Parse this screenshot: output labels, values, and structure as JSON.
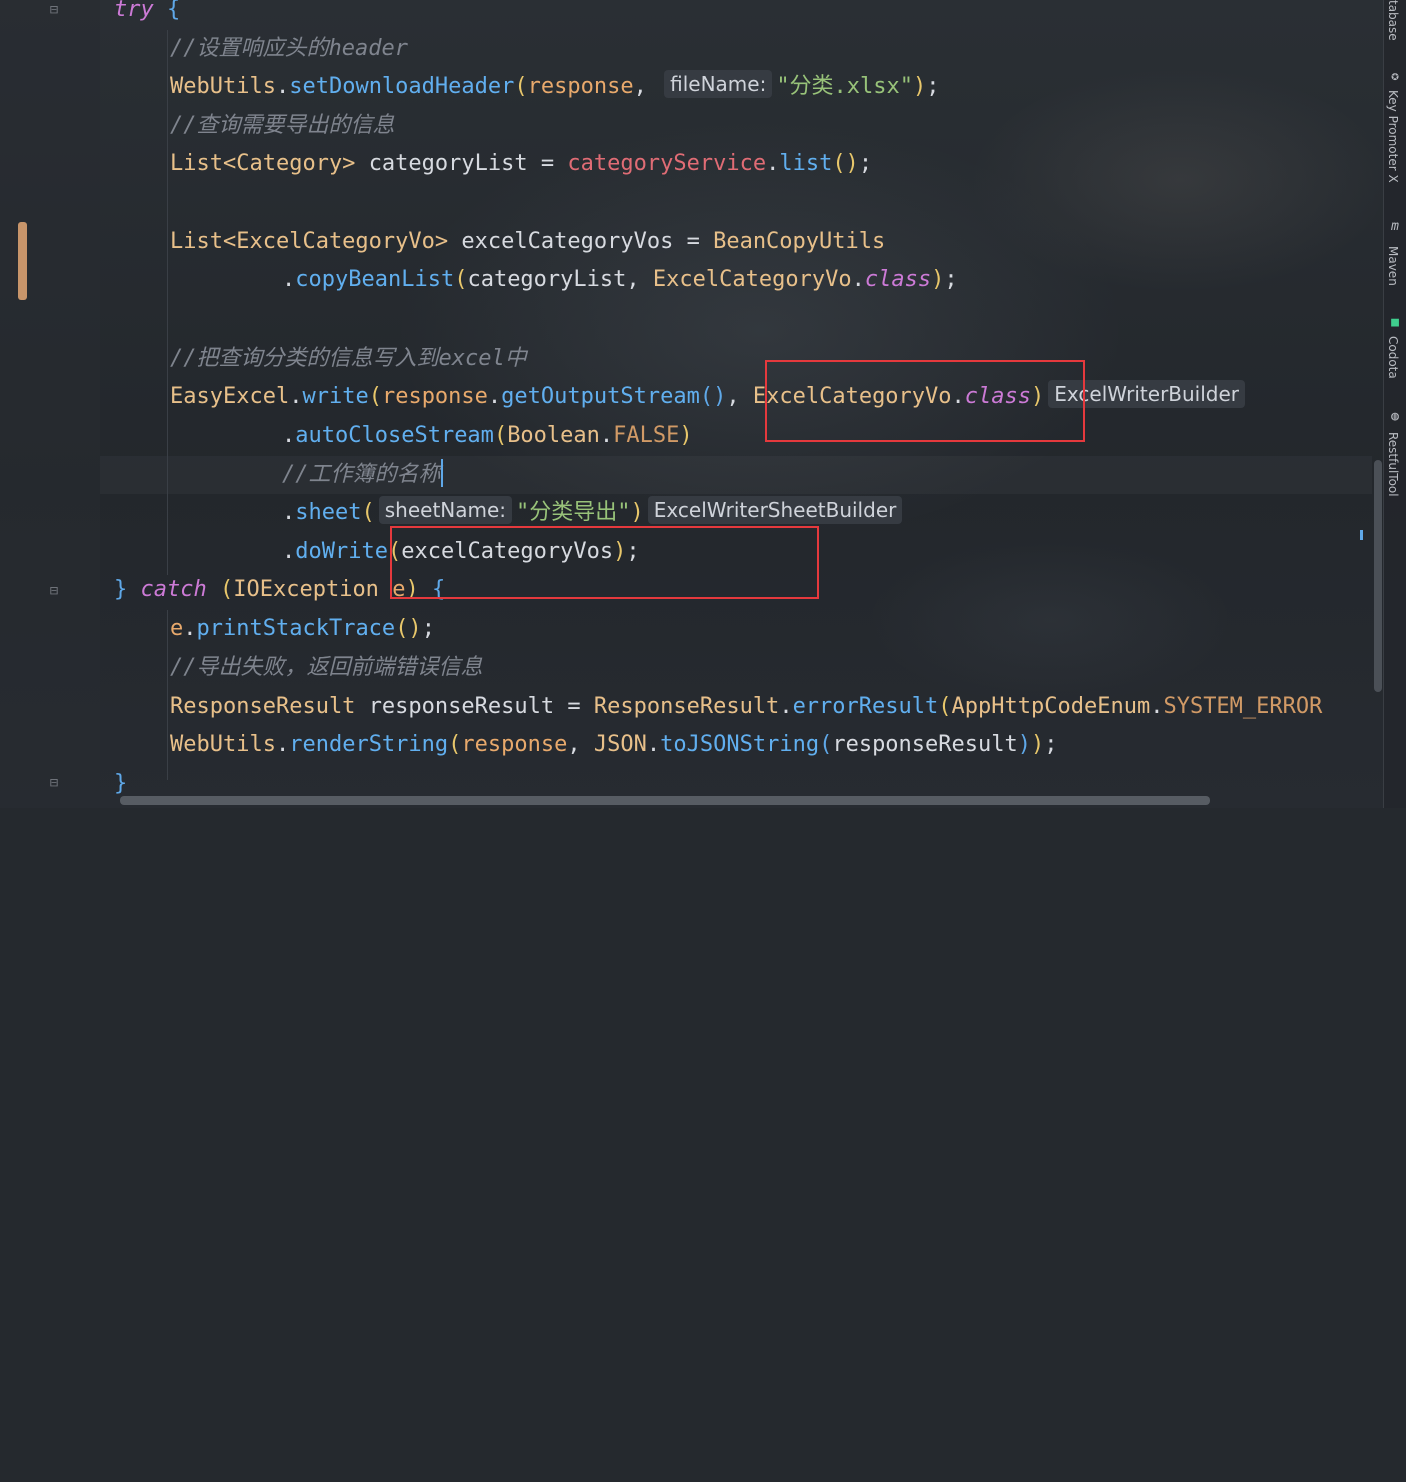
{
  "code": {
    "l1_try": "try",
    "l1_brace": "{",
    "l2_comment": "//设置响应头的header",
    "l3_cls": "WebUtils",
    "l3_fn": "setDownloadHeader",
    "l3_arg": "response",
    "l3_hint": "fileName:",
    "l3_str": "\"分类.xlsx\"",
    "l4_comment": "//查询需要导出的信息",
    "l5_type": "List<Category>",
    "l5_var": "categoryList",
    "l5_field": "categoryService",
    "l5_fn": "list",
    "l7_type": "List<ExcelCategoryVo>",
    "l7_var": "excelCategoryVos",
    "l7_cls": "BeanCopyUtils",
    "l8_fn": "copyBeanList",
    "l8_arg1": "categoryList",
    "l8_cls": "ExcelCategoryVo",
    "l8_kw": "class",
    "l10_comment": "//把查询分类的信息写入到excel中",
    "l11_cls": "EasyExcel",
    "l11_fn": "write",
    "l11_obj": "response",
    "l11_fn2": "getOutputStream",
    "l11_cls2": "ExcelCategoryVo",
    "l11_kw": "class",
    "l11_hint": "ExcelWriterBuilder",
    "l12_fn": "autoCloseStream",
    "l12_cls": "Boolean",
    "l12_const": "FALSE",
    "l13_comment": "//工作簿的名称",
    "l14_fn": "sheet",
    "l14_hint": "sheetName:",
    "l14_str": "\"分类导出\"",
    "l14_hint2": "ExcelWriterSheetBuilder",
    "l15_fn": "doWrite",
    "l15_arg": "excelCategoryVos",
    "l16_kw": "catch",
    "l16_cls": "IOException",
    "l16_var": "e",
    "l17_obj": "e",
    "l17_fn": "printStackTrace",
    "l18_comment": "//导出失败，返回前端错误信息",
    "l19_cls": "ResponseResult",
    "l19_var": "responseResult",
    "l19_cls2": "ResponseResult",
    "l19_fn": "errorResult",
    "l19_cls3": "AppHttpCodeEnum",
    "l19_const": "SYSTEM_ERROR",
    "l20_cls": "WebUtils",
    "l20_fn": "renderString",
    "l20_arg": "response",
    "l20_cls2": "JSON",
    "l20_fn2": "toJSONString",
    "l20_arg2": "responseResult",
    "l21_brace": "}"
  },
  "right_toolbar": {
    "database": "tabase",
    "key_promoter": "Key Promoter X",
    "maven": "Maven",
    "codota": "Codota",
    "restful": "RestfulTool"
  },
  "colors": {
    "background": "#25292e",
    "keyword": "#cc7ad6",
    "function": "#61afef",
    "class": "#e8c08a",
    "string": "#98c379",
    "comment": "#7f848e",
    "highlight_box": "#e5393d"
  }
}
